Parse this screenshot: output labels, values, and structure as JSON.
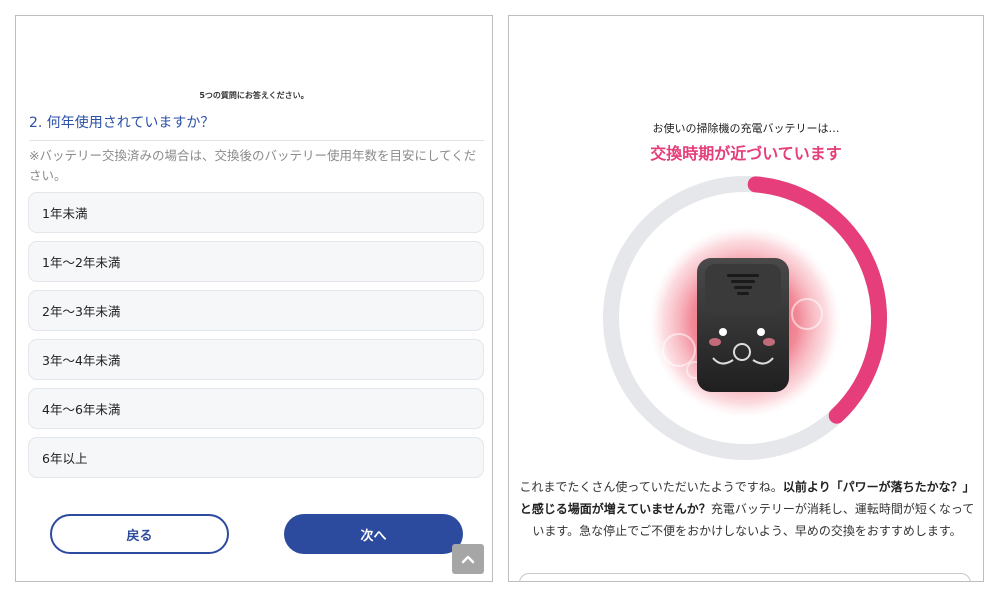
{
  "quiz": {
    "progress_note": "5つの質問にお答えください。",
    "question": "2. 何年使用されていますか？",
    "note": "※バッテリー交換済みの場合は、交換後のバッテリー使用年数を目安にしてください。",
    "options": [
      {
        "label": "1年未満"
      },
      {
        "label": "1年〜2年未満"
      },
      {
        "label": "2年〜3年未満"
      },
      {
        "label": "3年〜4年未満"
      },
      {
        "label": "4年〜6年未満"
      },
      {
        "label": "6年以上"
      }
    ],
    "back_label": "戻る",
    "next_label": "次へ",
    "scroll_top_icon": "chevron-up-icon"
  },
  "result": {
    "subtitle": "お使いの掃除機の充電バッテリーは…",
    "headline": "交換時期が近づいています",
    "gauge_level": 0.38,
    "desc_part1": "これまでたくさん使っていただいたようですね。",
    "desc_bold": "以前より「パワーが落ちたかな？」と感じる場面が増えていませんか？",
    "desc_part2": "充電バッテリーが消耗し、運転時間が短くなっています。急な停止でご不便をおかけしないよう、早めの交換をおすすめします。"
  },
  "colors": {
    "brand_blue": "#2c4a9e",
    "accent_pink": "#e53e7a",
    "gauge_track": "#e6e7ea"
  }
}
